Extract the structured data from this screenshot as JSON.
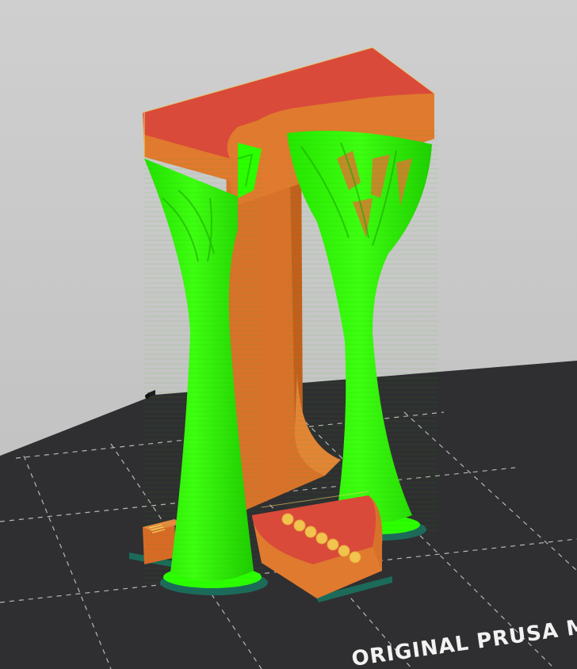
{
  "viewer": {
    "printer_label": "ORIGINAL PRUSA MINI",
    "scene_description_hidden": true
  },
  "colors": {
    "background": "#c9c9c9",
    "bed": "#2f2f31",
    "bed_edge": "#1f1f21",
    "grid_line": "#d8d8d8",
    "perimeter_orange": "#e07a2e",
    "perimeter_orange_dark": "#c8621f",
    "top_solid_red": "#d94a3a",
    "support_green": "#2bff00",
    "support_green_dark": "#1ed000",
    "skirt_teal": "#1c6b5a",
    "gap_fill_yellow": "#f0d060",
    "label_text": "#f2f2f2"
  },
  "icons": {
    "bed": "print-bed-icon",
    "model": "sliced-model-icon"
  }
}
